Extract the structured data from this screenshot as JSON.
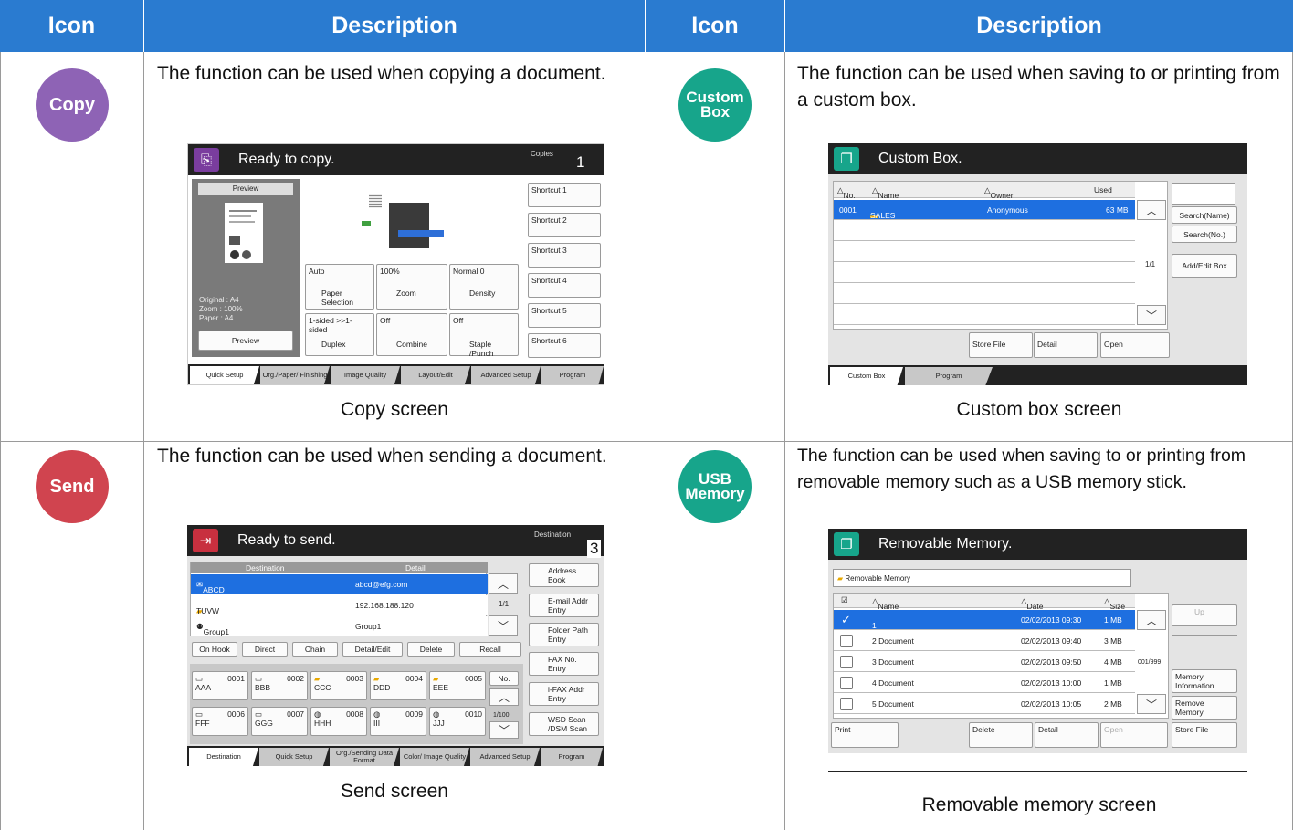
{
  "headers": {
    "icon1": "Icon",
    "desc1": "Description",
    "icon2": "Icon",
    "desc2": "Description"
  },
  "colors": {
    "header": "#2a7bd0",
    "copy": "#8e63b5",
    "custom_box": "#17a58b",
    "send": "#d0444f",
    "usb_memory": "#17a58b"
  },
  "copy": {
    "icon_label": "Copy",
    "description": "The function can be used when copying a document.",
    "caption": "Copy screen",
    "screen": {
      "title": "Ready to copy.",
      "copies_label": "Copies",
      "copies_value": "1",
      "preview_label": "Preview",
      "orig_lines": [
        [
          "Original",
          "A4"
        ],
        [
          "Zoom",
          "100%"
        ],
        [
          "Paper",
          "A4"
        ]
      ],
      "preview_button": "Preview",
      "funcs": [
        {
          "value": "Auto",
          "label": "Paper Selection"
        },
        {
          "value": "100%",
          "label": "Zoom"
        },
        {
          "value": "Normal 0",
          "label": "Density"
        },
        {
          "value": "1-sided >>1-sided",
          "label": "Duplex"
        },
        {
          "value": "Off",
          "label": "Combine"
        },
        {
          "value": "Off",
          "label": "Staple /Punch"
        }
      ],
      "shortcuts": [
        "Shortcut 1",
        "Shortcut 2",
        "Shortcut 3",
        "Shortcut 4",
        "Shortcut 5",
        "Shortcut 6"
      ],
      "tabs": [
        "Quick Setup",
        "Org./Paper/ Finishing",
        "Image Quality",
        "Layout/Edit",
        "Advanced Setup",
        "Program"
      ]
    }
  },
  "custom_box": {
    "icon_label_line1": "Custom",
    "icon_label_line2": "Box",
    "description": "The function can be used when saving to or printing from a custom box.",
    "caption": "Custom box screen",
    "screen": {
      "title": "Custom Box.",
      "columns": [
        "No.",
        "Name",
        "Owner",
        "Used"
      ],
      "row": {
        "no": "0001",
        "name": "SALES",
        "owner": "Anonymous",
        "used": "63 MB"
      },
      "page": "1/1",
      "side_buttons": [
        "Search(Name)",
        "Search(No.)",
        "Add/Edit Box"
      ],
      "bottom_buttons": [
        "Store File",
        "Detail",
        "Open"
      ],
      "tabs": [
        "Custom Box",
        "Program"
      ]
    }
  },
  "send": {
    "icon_label": "Send",
    "description": "The function can be used when sending a document.",
    "caption": "Send screen",
    "screen": {
      "title": "Ready to send.",
      "dest_label": "Destination",
      "dest_value": "3",
      "columns": [
        "Destination",
        "Detail"
      ],
      "rows": [
        {
          "name": "ABCD",
          "detail": "abcd@efg.com"
        },
        {
          "name": "TUVW",
          "detail": "192.168.188.120"
        },
        {
          "name": "Group1",
          "detail": "Group1"
        }
      ],
      "page": "1/1",
      "action_buttons": [
        "On Hook",
        "Direct",
        "Chain",
        "Detail/Edit",
        "Delete",
        "Recall"
      ],
      "book": [
        {
          "no": "0001",
          "name": "AAA"
        },
        {
          "no": "0002",
          "name": "BBB"
        },
        {
          "no": "0003",
          "name": "CCC"
        },
        {
          "no": "0004",
          "name": "DDD"
        },
        {
          "no": "0005",
          "name": "EEE"
        },
        {
          "no": "0006",
          "name": "FFF"
        },
        {
          "no": "0007",
          "name": "GGG"
        },
        {
          "no": "0008",
          "name": "HHH"
        },
        {
          "no": "0009",
          "name": "III"
        },
        {
          "no": "0010",
          "name": "JJJ"
        }
      ],
      "no_button": "No.",
      "book_page": "1/100",
      "side_buttons": [
        "Address Book",
        "E-mail Addr Entry",
        "Folder Path Entry",
        "FAX No. Entry",
        "i-FAX Addr Entry",
        "WSD Scan /DSM Scan"
      ],
      "tabs": [
        "Destination",
        "Quick Setup",
        "Org./Sending Data Format",
        "Color/ Image Quality",
        "Advanced Setup",
        "Program"
      ]
    }
  },
  "usb": {
    "icon_label_line1": "USB",
    "icon_label_line2": "Memory",
    "description": "The function can be used when saving to or printing from removable memory such as a USB memory stick.",
    "caption": "Removable memory screen",
    "screen": {
      "title": "Removable Memory.",
      "path": "Removable Memory",
      "columns": [
        "Name",
        "Date and Time",
        "Size"
      ],
      "rows": [
        {
          "name": "1 Document",
          "date": "02/02/2013 09:30",
          "size": "1 MB"
        },
        {
          "name": "2 Document",
          "date": "02/02/2013 09:40",
          "size": "3 MB"
        },
        {
          "name": "3 Document",
          "date": "02/02/2013 09:50",
          "size": "4 MB"
        },
        {
          "name": "4 Document",
          "date": "02/02/2013 10:00",
          "size": "1 MB"
        },
        {
          "name": "5 Document",
          "date": "02/02/2013 10:05",
          "size": "2 MB"
        }
      ],
      "page": "001/999",
      "up_button": "Up",
      "side_buttons": [
        "Memory Information",
        "Remove Memory"
      ],
      "bottom_buttons": [
        "Print",
        "Delete",
        "Detail",
        "Open",
        "Store File"
      ]
    }
  }
}
